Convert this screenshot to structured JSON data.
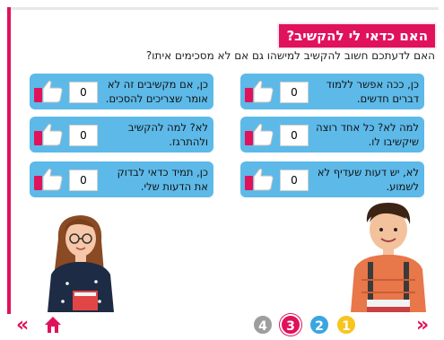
{
  "header": {
    "title": "האם כדאי לי להקשיב?",
    "question": "האם לדעתכם חשוב להקשיב למישהו גם אם לא מסכימים איתו?"
  },
  "options": [
    {
      "label": "כן, ככה אפשר ללמוד דברים חדשים.",
      "count": "0"
    },
    {
      "label": "כן, אם מקשיבים זה לא אומר שצריכים להסכים.",
      "count": "0"
    },
    {
      "label": "למה לא? כל אחד רוצה שיקשיבו לו.",
      "count": "0"
    },
    {
      "label": "לא? למה להקשיב ולהתרגז.",
      "count": "0"
    },
    {
      "label": "לא, יש דעות שעדיף לא לשמוע.",
      "count": "0"
    },
    {
      "label": "כן, תמיד כדאי לבדוק את הדעות שלי.",
      "count": "0"
    }
  ],
  "pagination": {
    "pages": [
      {
        "label": "1",
        "color": "#f7c51f"
      },
      {
        "label": "2",
        "color": "#3aa6e0"
      },
      {
        "label": "3",
        "color": "#e0125b"
      },
      {
        "label": "4",
        "color": "#9e9e9e"
      }
    ],
    "current": "3"
  },
  "colors": {
    "accent": "#e0125b",
    "card": "#5db9e8"
  },
  "icons": {
    "like": "thumbs-up-icon",
    "home": "home-icon",
    "prev": "double-chevron-left-icon",
    "next": "double-chevron-right-icon"
  }
}
